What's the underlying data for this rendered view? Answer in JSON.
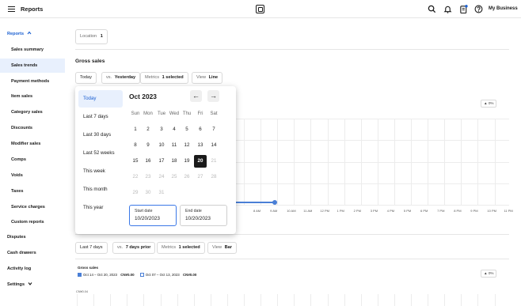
{
  "header": {
    "title": "Reports",
    "business": "My Business",
    "icons": [
      "menu-icon",
      "square-logo-icon",
      "search-icon",
      "bell-icon",
      "clipboard-icon",
      "help-icon"
    ]
  },
  "sidebar": {
    "reports_label": "Reports",
    "items": [
      "Sales summary",
      "Sales trends",
      "Payment methods",
      "Item sales",
      "Category sales",
      "Discounts",
      "Modifier sales",
      "Comps",
      "Voids",
      "Taxes",
      "Service charges",
      "Custom reports"
    ],
    "bottom_items": [
      "Disputes",
      "Cash drawers",
      "Activity log",
      "Settings"
    ]
  },
  "filters": {
    "location_label": "Location",
    "location_count": "1"
  },
  "gross_sales": {
    "title": "Gross sales",
    "date_chip": "Today",
    "compare_prefix": "vs.",
    "compare_value": "Yesterday",
    "metrics_label": "Metrics",
    "metrics_value": "1 selected",
    "view_label": "View",
    "view_value": "Line",
    "change_badge": "▲ 0%"
  },
  "chart_data": {
    "type": "line",
    "x": [
      "8 AM",
      "9 AM",
      "10 AM",
      "11 AM",
      "12 PM",
      "1 PM",
      "2 PM",
      "3 PM",
      "4 PM",
      "5 PM",
      "6 PM",
      "7 PM",
      "8 PM",
      "9 PM",
      "10 PM",
      "11 PM"
    ],
    "series": [
      {
        "values": [
          0,
          0,
          0
        ]
      }
    ],
    "grid": true
  },
  "second_section": {
    "date_chip": "Last 7 days",
    "compare_prefix": "vs.",
    "compare_value": "7 days prior",
    "metrics_label": "Metrics",
    "metrics_value": "1 selected",
    "view_label": "View",
    "view_value": "Bar",
    "legend_title": "Gross sales",
    "legend_current_range": "Oct 14 – Oct 20, 2023",
    "legend_current_value": "CN¥0.00",
    "legend_prior_range": "Oct 07 – Oct 13, 2023",
    "legend_prior_value": "CN¥0.00",
    "y_label": "CN¥0.04",
    "change_badge": "▲ 0%"
  },
  "datepicker": {
    "presets": [
      "Today",
      "Last 7 days",
      "Last 30 days",
      "Last 52 weeks",
      "This week",
      "This month",
      "This year"
    ],
    "month_label": "Oct 2023",
    "weekdays": [
      "Sun",
      "Mon",
      "Tue",
      "Wed",
      "Thu",
      "Fri",
      "Sat"
    ],
    "weeks": [
      [
        "1",
        "2",
        "3",
        "4",
        "5",
        "6",
        "7"
      ],
      [
        "8",
        "9",
        "10",
        "11",
        "12",
        "13",
        "14"
      ],
      [
        "15",
        "16",
        "17",
        "18",
        "19",
        "20",
        "21"
      ],
      [
        "22",
        "23",
        "24",
        "25",
        "26",
        "27",
        "28"
      ],
      [
        "29",
        "30",
        "31",
        "",
        "",
        "",
        ""
      ]
    ],
    "selected_day": "20",
    "start_label": "Start date",
    "start_value": "10/20/2023",
    "end_label": "End date",
    "end_value": "10/20/2023",
    "prev_icon": "←",
    "next_icon": "→"
  }
}
